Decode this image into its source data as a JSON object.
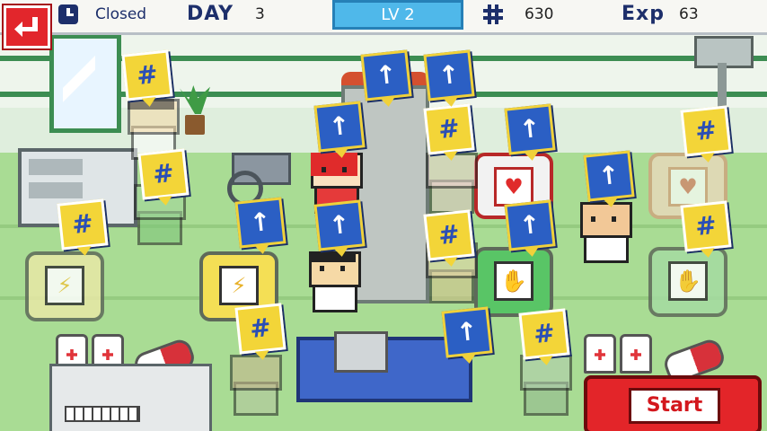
{
  "hud": {
    "status": "Closed",
    "day_label": "DAY",
    "day_value": "3",
    "level": "LV 2",
    "money_value": "630",
    "exp_label": "Exp",
    "exp_value": "63"
  },
  "buttons": {
    "start": "Start"
  },
  "icons": {
    "back": "back-arrow-icon",
    "clock": "clock-icon",
    "money": "money-icon",
    "upgrade": "up-arrow-icon"
  },
  "colors": {
    "hud_text": "#1d2f6b",
    "level_box": "#4fb8ea",
    "start_button": "#e32529",
    "upgrade_bubble": "#2b5fc4",
    "money_bubble": "#f3d538"
  }
}
